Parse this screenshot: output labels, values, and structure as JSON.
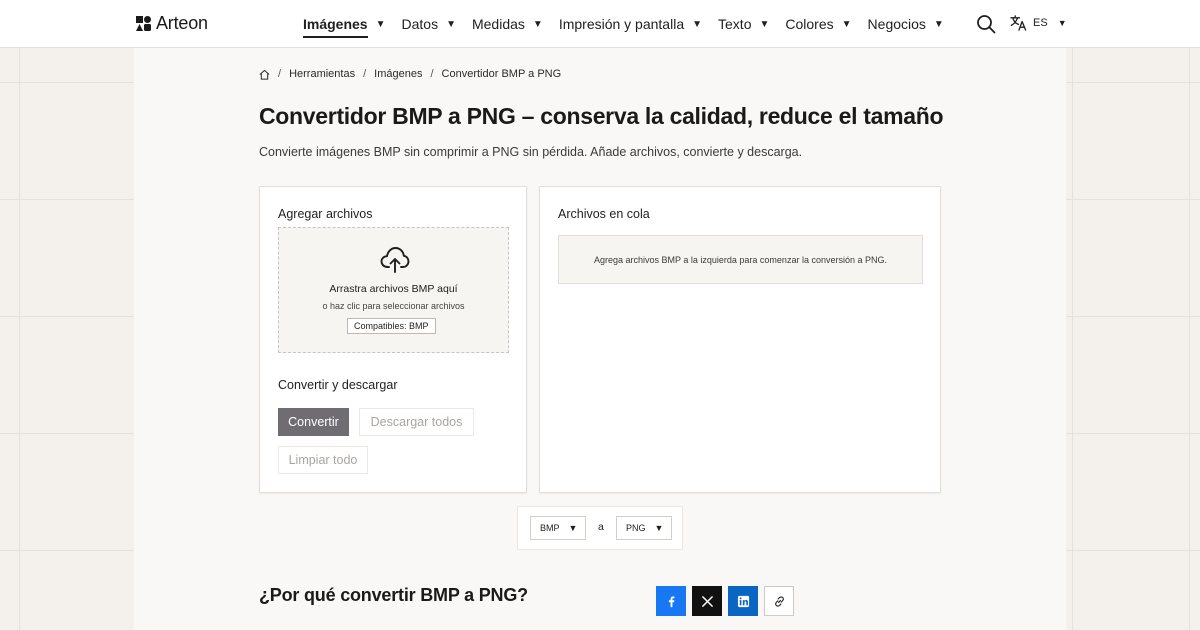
{
  "header": {
    "logo_text": "Arteon",
    "nav": [
      {
        "label": "Imágenes",
        "active": true
      },
      {
        "label": "Datos"
      },
      {
        "label": "Medidas"
      },
      {
        "label": "Impresión y pantalla"
      },
      {
        "label": "Texto"
      },
      {
        "label": "Colores"
      },
      {
        "label": "Negocios"
      }
    ],
    "caret": "▼",
    "lang_code": "ES",
    "icons": {
      "search": "search-icon",
      "language": "translate-icon",
      "home": "home-icon"
    }
  },
  "breadcrumb": {
    "sep": "/",
    "items": [
      "Herramientas",
      "Imágenes",
      "Convertidor BMP a PNG"
    ]
  },
  "page": {
    "title": "Convertidor BMP a PNG – conserva la calidad, reduce el tamaño",
    "subtitle": "Convierte imágenes BMP sin comprimir a PNG sin pérdida. Añade archivos, convierte y descarga."
  },
  "upload": {
    "title": "Agregar archivos",
    "drop_main": "Arrastra archivos BMP aquí",
    "drop_sub": "o haz clic para seleccionar archivos",
    "badge": "Compatibles: BMP",
    "icon": "cloud-upload-icon"
  },
  "actions": {
    "title": "Convertir y descargar",
    "convert": "Convertir",
    "download_all": "Descargar todos",
    "clear_all": "Limpiar todo"
  },
  "queue": {
    "title": "Archivos en cola",
    "empty": "Agrega archivos BMP a la izquierda para comenzar la conversión a PNG."
  },
  "formats": {
    "from": "BMP",
    "to": "PNG",
    "sep": "a"
  },
  "why": {
    "title": "¿Por qué convertir BMP a PNG?"
  },
  "share": {
    "icons": [
      "facebook-icon",
      "x-icon",
      "linkedin-icon",
      "link-icon"
    ],
    "colors": {
      "facebook": "#1877f2",
      "x": "#111111",
      "linkedin": "#0a66c2"
    }
  },
  "colors": {
    "accent": "#6f6d72",
    "background": "#f4f1ed"
  }
}
